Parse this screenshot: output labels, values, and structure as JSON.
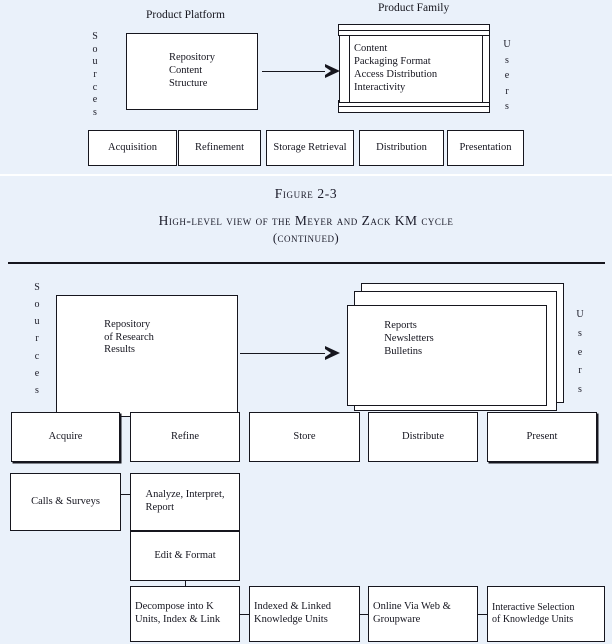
{
  "page": {
    "background_color": "#eaf1fa",
    "ink_color": "#16161e"
  },
  "figure_top": {
    "platform_label": "Product Platform",
    "family_label": "Product Family",
    "sources_label": "Sources",
    "users_label": "Users",
    "platform_box_text": "Repository\nContent\n   Structure",
    "family_box_text": "Content\nPackaging Format\nAccess Distribution\nInteractivity",
    "stages": [
      "Acquisition",
      "Refinement",
      "Storage Retrieval",
      "Distribution",
      "Presentation"
    ]
  },
  "caption": {
    "figure_number": "Figure 2-3",
    "title": "High-level view of the Meyer and Zack KM cycle",
    "continued": "(continued)"
  },
  "figure_bottom": {
    "sources_label": "Sources",
    "users_label": "Users",
    "repository_box_text": "Repository\nof Research\nResults",
    "outputs_box_text": "Reports\nNewsletters\nBulletins",
    "stages": [
      "Acquire",
      "Refine",
      "Store",
      "Distribute",
      "Present"
    ],
    "flow": {
      "calls_surveys": "Calls & Surveys",
      "analyze": "Analyze, Interpret,\nReport",
      "edit_format": "Edit & Format",
      "decompose": "Decompose into K\nUnits, Index & Link",
      "indexed": "Indexed & Linked\nKnowledge Units",
      "online": "Online Via Web &\nGroupware",
      "interactive": "Interactive Selection\nof Knowledge Units"
    }
  }
}
